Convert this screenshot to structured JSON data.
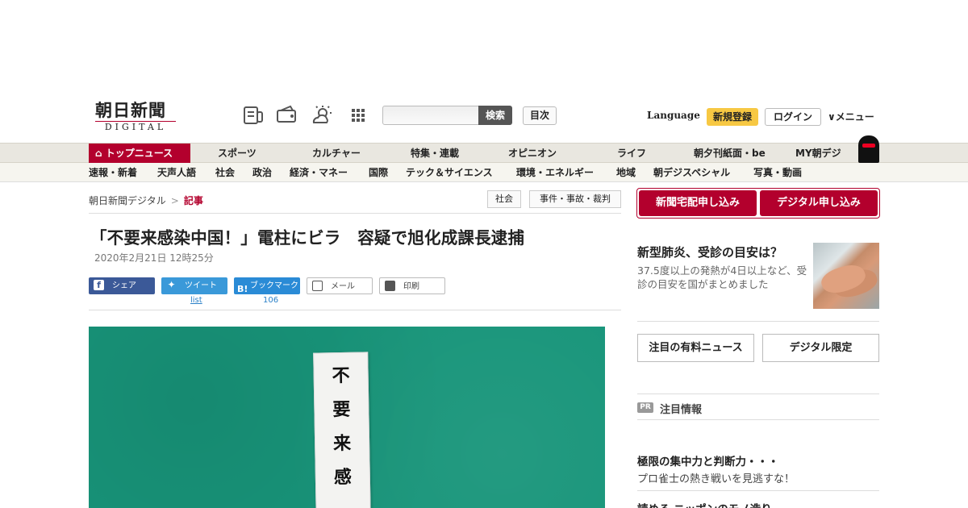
{
  "header": {
    "logo_main": "朝日新聞",
    "logo_sub": "DIGITAL",
    "icons": [
      "newspaper-icon",
      "wallet-icon",
      "weather-icon",
      "grid-menu-icon"
    ],
    "search_placeholder": "",
    "search_label": "検索",
    "toc_label": "目次",
    "language_label": "Language",
    "signup_label": "新規登録",
    "login_label": "ログイン",
    "menu_label": "メニュー"
  },
  "nav_main": {
    "items": [
      "トップニュース",
      "スポーツ",
      "カルチャー",
      "特集・連載",
      "オピニオン",
      "ライフ",
      "朝夕刊紙面・be",
      "MY朝デジ"
    ]
  },
  "nav_sub": {
    "items": [
      "速報・新着",
      "天声人語",
      "社会",
      "政治",
      "経済・マネー",
      "国際",
      "テック＆サイエンス",
      "環境・エネルギー",
      "地域",
      "朝デジスペシャル",
      "写真・動画"
    ]
  },
  "breadcrumb": {
    "home": "朝日新聞デジタル",
    "separator": ">",
    "current": "記事"
  },
  "tags": [
    "社会",
    "事件・事故・裁判"
  ],
  "article": {
    "title": "「不要来感染中国！」電柱にビラ　容疑で旭化成課長逮捕",
    "date": "2020年2月21日 12時25分"
  },
  "share": {
    "facebook": "シェア",
    "twitter": "ツイート",
    "twitter_count": "list",
    "hatena": "ブックマーク",
    "hatena_count": "106",
    "mail": "メール",
    "print": "印刷"
  },
  "photo": {
    "flyer_text": [
      "不",
      "要",
      "来",
      "感"
    ]
  },
  "sidebar": {
    "subscribe_paper": "新聞宅配申し込み",
    "subscribe_digital": "デジタル申し込み",
    "news_title": "新型肺炎、受診の目安は？",
    "news_body": "37.5度以上の発熱が4日以上など、受診の目安を国がまとめました",
    "button_paid_news": "注目の有料ニュース",
    "button_digital_only": "デジタル限定",
    "pr_badge": "PR",
    "pr_label": "注目情報",
    "pr_item_title": "極限の集中力と判断力・・・",
    "pr_item_body": "プロ雀士の熱き戦いを見逃すな！",
    "pr_item2_title": "読める ニッポンのモノ造り"
  },
  "colors": {
    "brand_red": "#b3002d",
    "signup_yellow": "#f7c843",
    "facebook": "#3b5998",
    "twitter": "#3a99d9",
    "hatena": "#2a8bd6",
    "photo_green": "#18957a"
  }
}
